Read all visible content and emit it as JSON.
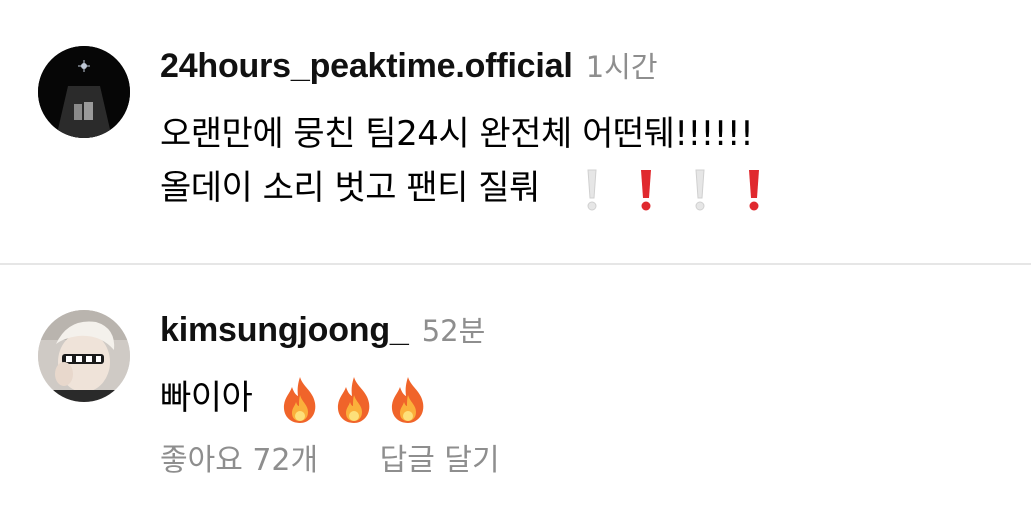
{
  "comments": [
    {
      "username": "24hours_peaktime.official",
      "time": "1시간",
      "lines": [
        "오랜만에 뭉친 팀24시 완전체 어떤뒈!!!!!!",
        "올데이 소리 벗고 팬티 질뤄"
      ],
      "emojis": [
        "white-exclamation-mark",
        "red-exclamation-mark",
        "white-exclamation-mark",
        "red-exclamation-mark"
      ]
    },
    {
      "username": "kimsungjoong_",
      "time": "52분",
      "lines": [
        "빠이아"
      ],
      "emojis": [
        "fire",
        "fire",
        "fire"
      ],
      "likes_label": "좋아요 72개",
      "reply_label": "답글 달기"
    }
  ],
  "colors": {
    "text": "#000000",
    "muted": "#8e8e8e",
    "divider": "#e6e6e6",
    "red_exclamation": "#e0292e",
    "white_exclamation": "#e4e4e4"
  }
}
